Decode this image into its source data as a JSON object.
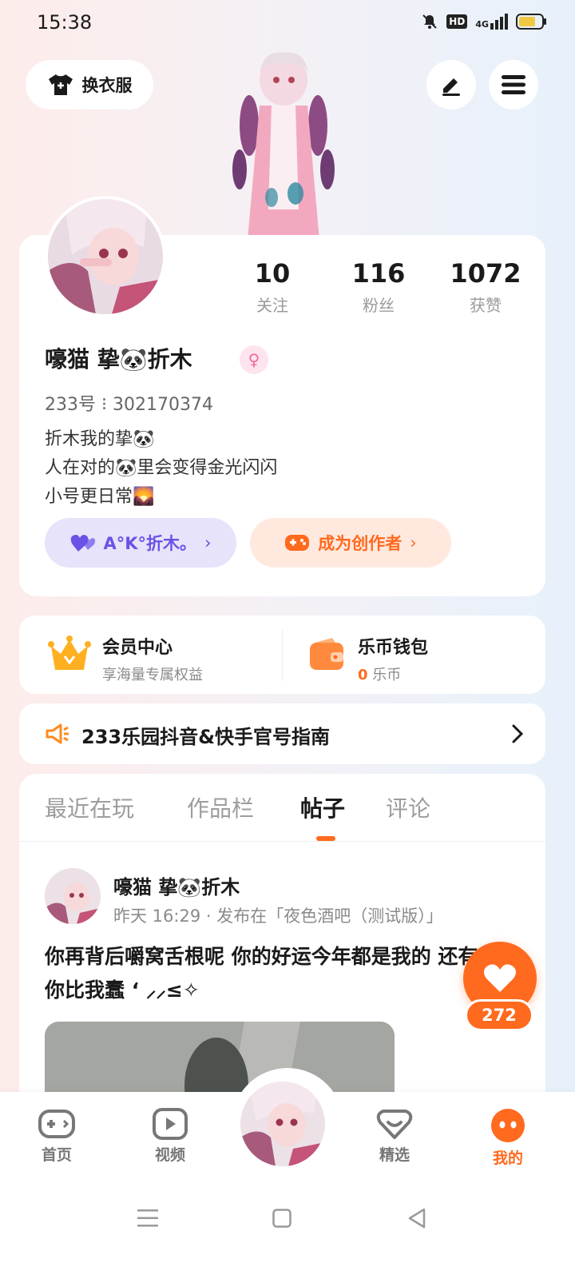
{
  "status_bar": {
    "time": "15:38",
    "network": "4G",
    "hd": "HD"
  },
  "header": {
    "change_outfit_label": "换衣服"
  },
  "profile": {
    "stats": [
      {
        "value": "10",
        "label": "关注"
      },
      {
        "value": "116",
        "label": "粉丝"
      },
      {
        "value": "1072",
        "label": "获赞"
      }
    ],
    "username": "嚎猫 挚🐼折木",
    "gender_symbol": "♀",
    "user_id": "233号 ⁝ 302170374",
    "bio_lines": [
      "折木我的挚🐼",
      "人在对的🐼里会变得金光闪闪",
      "小号更日常🌄"
    ],
    "tag_label": "A°K°折木。",
    "creator_label": "成为创作者"
  },
  "membership": {
    "title": "会员中心",
    "subtitle": "享海量专属权益"
  },
  "wallet": {
    "title": "乐币钱包",
    "amount": "0",
    "unit": "乐币"
  },
  "notice": {
    "text": "233乐园抖音&快手官号指南"
  },
  "tabs": [
    {
      "label": "最近在玩"
    },
    {
      "label": "作品栏"
    },
    {
      "label": "帖子"
    },
    {
      "label": "评论"
    }
  ],
  "post": {
    "author": "嚎猫 挚🐼折木",
    "meta": "昨天 16:29 · 发布在「夜色酒吧（测试版）」",
    "text": "你再背后嚼窝舌根呢 你的好运今年都是我的 还有你比我蠢 ‘ ⸝⸝≤✧",
    "likes": "272"
  },
  "bottom_nav": [
    {
      "label": "首页"
    },
    {
      "label": "视频"
    },
    {
      "label": "精选"
    },
    {
      "label": "我的"
    }
  ],
  "colors": {
    "accent": "#ff6a1e",
    "purple": "#6a52e6",
    "pink": "#f06a9c"
  }
}
